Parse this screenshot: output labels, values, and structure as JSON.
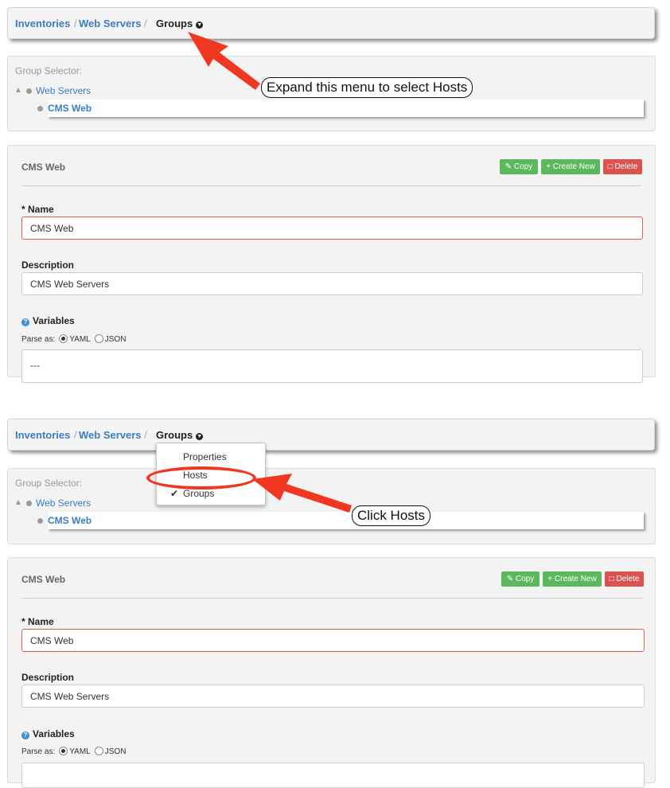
{
  "screenshots": [
    {
      "breadcrumb": {
        "items": [
          "Inventories",
          "Web Servers"
        ],
        "separator": "/",
        "current": "Groups"
      },
      "group_selector": {
        "label": "Group Selector:",
        "parent": "Web Servers",
        "child": "CMS Web"
      },
      "panel": {
        "title": "CMS Web",
        "buttons": {
          "copy": "Copy",
          "create_new": "Create New",
          "delete": "Delete"
        },
        "name_label": "* Name",
        "name_value": "CMS Web",
        "description_label": "Description",
        "description_value": "CMS Web Servers",
        "variables_label": "Variables",
        "parse_as_label": "Parse as:",
        "parse_options": [
          "YAML",
          "JSON"
        ],
        "parse_selected": "YAML",
        "variables_value": "---"
      },
      "annotation": "Expand this menu to select Hosts"
    },
    {
      "breadcrumb": {
        "items": [
          "Inventories",
          "Web Servers"
        ],
        "separator": "/",
        "current": "Groups"
      },
      "dropdown": {
        "items": [
          "Properties",
          "Hosts",
          "Groups"
        ],
        "checked": "Groups",
        "highlighted": "Hosts"
      },
      "group_selector": {
        "label": "Group Selector:",
        "parent": "Web Servers",
        "child": "CMS Web"
      },
      "panel": {
        "title": "CMS Web",
        "buttons": {
          "copy": "Copy",
          "create_new": "Create New",
          "delete": "Delete"
        },
        "name_label": "* Name",
        "name_value": "CMS Web",
        "description_label": "Description",
        "description_value": "CMS Web Servers",
        "variables_label": "Variables",
        "parse_as_label": "Parse as:",
        "parse_options": [
          "YAML",
          "JSON"
        ],
        "parse_selected": "YAML"
      },
      "annotation": "Click Hosts"
    }
  ],
  "icons": {
    "caret": "chevron-down-circle-icon",
    "tree": "sitemap-icon",
    "copy": "edit-icon",
    "create": "plus-icon",
    "delete": "trash-icon",
    "help": "question-circle-icon",
    "check": "check-icon"
  },
  "colors": {
    "link": "#3a7dc2",
    "success": "#5cb85c",
    "danger": "#d9534f",
    "annotation_arrow": "#f0371f",
    "error_border": "#e05a5a"
  }
}
